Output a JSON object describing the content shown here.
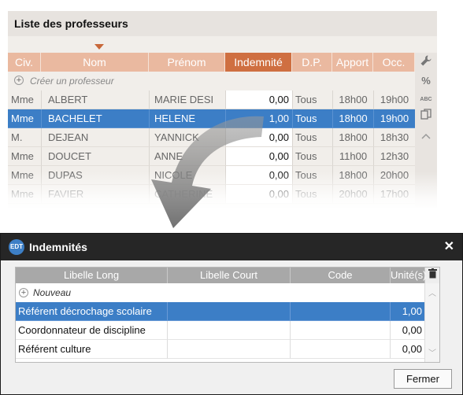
{
  "top": {
    "title": "Liste des professeurs",
    "columns": [
      "Civ.",
      "Nom",
      "Prénom",
      "Indemnité",
      "D.P.",
      "Apport",
      "Occ."
    ],
    "create_label": "Créer un professeur",
    "rows": [
      {
        "civ": "Mme",
        "nom": "ALBERT",
        "prenom": "MARIE DESI",
        "indemnite": "0,00",
        "dp": "Tous",
        "apport": "18h00",
        "occ": "19h00"
      },
      {
        "civ": "Mme",
        "nom": "BACHELET",
        "prenom": "HELENE",
        "indemnite": "1,00",
        "dp": "Tous",
        "apport": "18h00",
        "occ": "19h00"
      },
      {
        "civ": "M.",
        "nom": "DEJEAN",
        "prenom": "YANNICK",
        "indemnite": "0,00",
        "dp": "Tous",
        "apport": "18h00",
        "occ": "18h30"
      },
      {
        "civ": "Mme",
        "nom": "DOUCET",
        "prenom": "ANNE",
        "indemnite": "0,00",
        "dp": "Tous",
        "apport": "11h00",
        "occ": "12h30"
      },
      {
        "civ": "Mme",
        "nom": "DUPAS",
        "prenom": "NICOLE",
        "indemnite": "0,00",
        "dp": "Tous",
        "apport": "18h00",
        "occ": "20h00"
      },
      {
        "civ": "Mme",
        "nom": "FAVIER",
        "prenom": "CATHERINE",
        "indemnite": "0,00",
        "dp": "Tous",
        "apport": "20h00",
        "occ": "17h00"
      }
    ],
    "tools": {
      "percent": "%",
      "abc": "ABC"
    }
  },
  "dialog": {
    "logo": "EDT",
    "title": "Indemnités",
    "close": "✕",
    "columns": [
      "Libelle Long",
      "Libelle Court",
      "Code",
      "Unité(s)"
    ],
    "new_label": "Nouveau",
    "rows": [
      {
        "long": "Référent décrochage scolaire",
        "court": "",
        "code": "",
        "unites": "1,00"
      },
      {
        "long": "Coordonnateur de discipline",
        "court": "",
        "code": "",
        "unites": "0,00"
      },
      {
        "long": "Référent culture",
        "court": "",
        "code": "",
        "unites": "0,00"
      }
    ],
    "close_button": "Fermer"
  },
  "colors": {
    "header_orange": "#eab9a0",
    "active_orange": "#cf6f41",
    "selection_blue": "#3c7ec6",
    "dialog_titlebar": "#262626"
  }
}
